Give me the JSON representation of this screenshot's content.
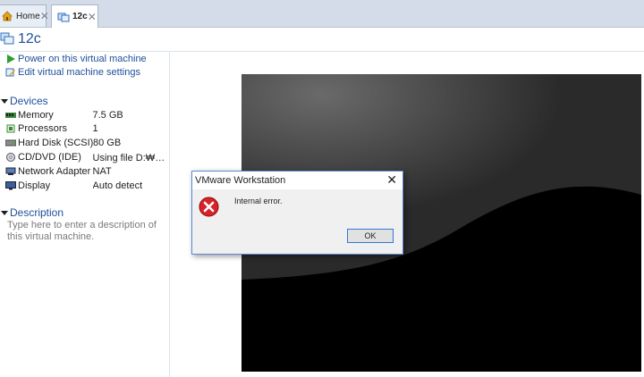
{
  "tabs": [
    {
      "label": "Home",
      "icon": "home-icon"
    },
    {
      "label": "12c",
      "icon": "vm-icon"
    }
  ],
  "vm": {
    "title": "12c"
  },
  "actions": [
    {
      "label": "Power on this virtual machine",
      "icon": "play-icon"
    },
    {
      "label": "Edit virtual machine settings",
      "icon": "settings-icon"
    }
  ],
  "devices": {
    "heading": "Devices",
    "items": [
      {
        "name": "Memory",
        "value": "7.5 GB",
        "icon": "memory-icon"
      },
      {
        "name": "Processors",
        "value": "1",
        "icon": "processor-icon"
      },
      {
        "name": "Hard Disk (SCSI)",
        "value": "80 GB",
        "icon": "hard-disk-icon"
      },
      {
        "name": "CD/DVD (IDE)",
        "value": "Using file D:₩팀프...",
        "icon": "cd-dvd-icon"
      },
      {
        "name": "Network Adapter",
        "value": "NAT",
        "icon": "network-icon"
      },
      {
        "name": "Display",
        "value": "Auto detect",
        "icon": "display-icon"
      }
    ]
  },
  "description": {
    "heading": "Description",
    "placeholder": "Type here to enter a description of this virtual machine."
  },
  "dialog": {
    "title": "VMware Workstation",
    "message": "Internal error.",
    "ok_label": "OK",
    "close_glyph": "✕",
    "icon": "error-icon"
  },
  "colors": {
    "accent": "#1e4f9b",
    "error": "#d8222a",
    "tabbar": "#d3dce8"
  }
}
